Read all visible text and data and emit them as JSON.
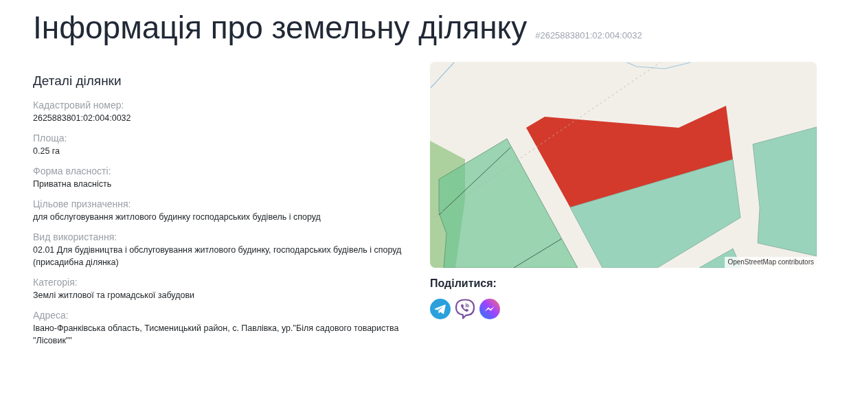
{
  "page": {
    "title": "Інформація про земельну ділянку",
    "cadastral_tag": "#2625883801:02:004:0032"
  },
  "details": {
    "heading": "Деталі ділянки",
    "fields": [
      {
        "label": "Кадастровий номер:",
        "value": "2625883801:02:004:0032"
      },
      {
        "label": "Площа:",
        "value": "0.25 га"
      },
      {
        "label": "Форма власності:",
        "value": "Приватна власність"
      },
      {
        "label": "Цільове призначення:",
        "value": "для обслуговування житлового будинку господарських будівель і споруд"
      },
      {
        "label": "Вид використання:",
        "value": "02.01 Для будівництва і обслуговування житлового будинку, господарських будівель і споруд (присадибна ділянка)"
      },
      {
        "label": "Категорія:",
        "value": "Землі житлової та громадської забудови"
      },
      {
        "label": "Адреса:",
        "value": "Івано-Франківська область, Тисменицький район, с. Павлівка, ур.\"Біля садового товариства \"Лісовик\"\""
      }
    ]
  },
  "map": {
    "attribution": "OpenStreetMap contributors"
  },
  "share": {
    "label": "Поділитися:",
    "buttons": [
      {
        "kind": "plane"
      },
      {
        "kind": "phone"
      },
      {
        "kind": "bolt"
      }
    ]
  }
}
